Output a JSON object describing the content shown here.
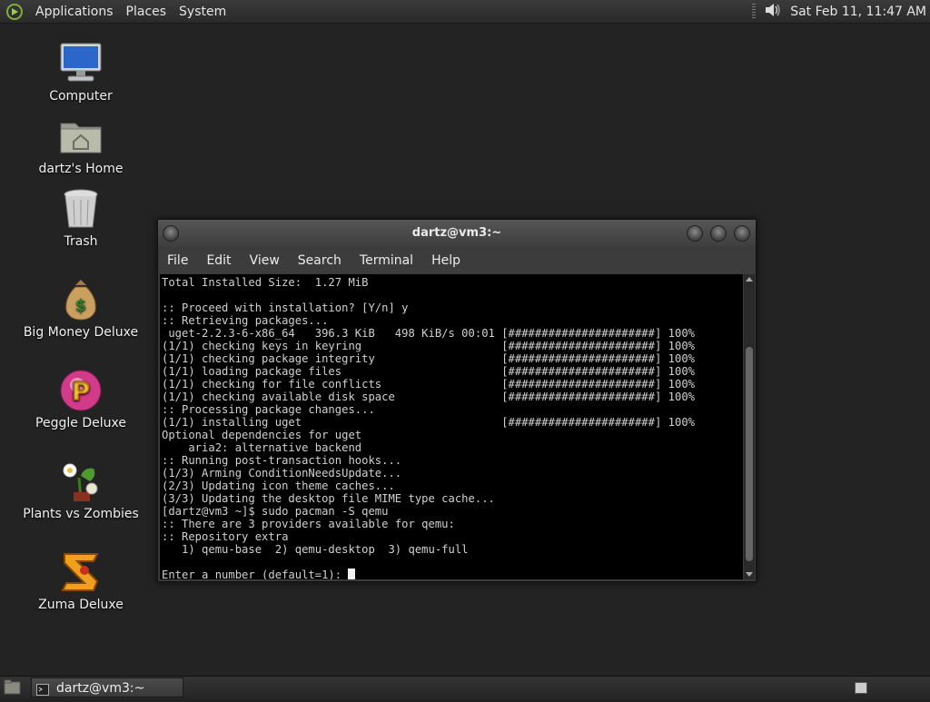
{
  "top_panel": {
    "menus": [
      "Applications",
      "Places",
      "System"
    ],
    "clock": "Sat Feb 11, 11:47 AM"
  },
  "desktop": {
    "icons": [
      {
        "label": "Computer",
        "icon": "computer-icon"
      },
      {
        "label": "dartz's Home",
        "icon": "home-folder-icon"
      },
      {
        "label": "Trash",
        "icon": "trash-icon"
      },
      {
        "label": "Big Money Deluxe",
        "icon": "money-bag-icon"
      },
      {
        "label": "Peggle Deluxe",
        "icon": "peggle-icon"
      },
      {
        "label": "Plants vs Zombies",
        "icon": "plants-vs-zombies-icon"
      },
      {
        "label": "Zuma Deluxe",
        "icon": "zuma-icon"
      }
    ]
  },
  "terminal": {
    "title": "dartz@vm3:~",
    "menus": [
      "File",
      "Edit",
      "View",
      "Search",
      "Terminal",
      "Help"
    ],
    "lines": [
      "Total Installed Size:  1.27 MiB",
      "",
      ":: Proceed with installation? [Y/n] y",
      ":: Retrieving packages...",
      " uget-2.2.3-6-x86_64   396.3 KiB   498 KiB/s 00:01 [######################] 100%",
      "(1/1) checking keys in keyring                     [######################] 100%",
      "(1/1) checking package integrity                   [######################] 100%",
      "(1/1) loading package files                        [######################] 100%",
      "(1/1) checking for file conflicts                  [######################] 100%",
      "(1/1) checking available disk space                [######################] 100%",
      ":: Processing package changes...",
      "(1/1) installing uget                              [######################] 100%",
      "Optional dependencies for uget",
      "    aria2: alternative backend",
      ":: Running post-transaction hooks...",
      "(1/3) Arming ConditionNeedsUpdate...",
      "(2/3) Updating icon theme caches...",
      "(3/3) Updating the desktop file MIME type cache...",
      "[dartz@vm3 ~]$ sudo pacman -S qemu",
      ":: There are 3 providers available for qemu:",
      ":: Repository extra",
      "   1) qemu-base  2) qemu-desktop  3) qemu-full",
      ""
    ],
    "prompt": "Enter a number (default=1): "
  },
  "taskbar": {
    "window_label": "dartz@vm3:~"
  }
}
